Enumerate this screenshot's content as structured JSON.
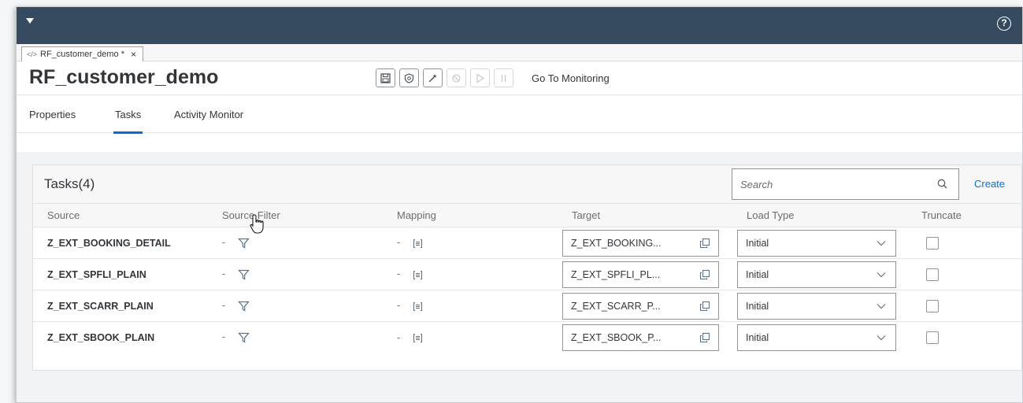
{
  "shell": {
    "help_glyph": "?"
  },
  "doc_tab": {
    "label": "RF_customer_demo *",
    "close": "×"
  },
  "title": "RF_customer_demo",
  "toolbar": {
    "buttons": [
      {
        "name": "save",
        "icon": "save-icon",
        "enabled": true
      },
      {
        "name": "deploy",
        "icon": "shield-icon",
        "enabled": true
      },
      {
        "name": "validate",
        "icon": "magic-wand-icon",
        "enabled": true
      },
      {
        "name": "undeploy",
        "icon": "undeploy-icon",
        "enabled": false
      },
      {
        "name": "run",
        "icon": "play-icon",
        "enabled": false
      },
      {
        "name": "pause",
        "icon": "pause-icon",
        "enabled": false
      }
    ],
    "monitoring_link": "Go To Monitoring"
  },
  "subtabs": [
    {
      "label": "Properties",
      "active": false
    },
    {
      "label": "Tasks",
      "active": true
    },
    {
      "label": "Activity Monitor",
      "active": false
    }
  ],
  "tasks": {
    "title": "Tasks(4)",
    "search_placeholder": "Search",
    "create_label": "Create",
    "columns": [
      "Source",
      "Source Filter",
      "Mapping",
      "Target",
      "Load Type",
      "Truncate"
    ],
    "rows": [
      {
        "source": "Z_EXT_BOOKING_DETAIL",
        "filter_dash": "-",
        "mapping_dash": "-",
        "target": "Z_EXT_BOOKING...",
        "load_type": "Initial",
        "truncate": false
      },
      {
        "source": "Z_EXT_SPFLI_PLAIN",
        "filter_dash": "-",
        "mapping_dash": "-",
        "target": "Z_EXT_SPFLI_PL...",
        "load_type": "Initial",
        "truncate": false
      },
      {
        "source": "Z_EXT_SCARR_PLAIN",
        "filter_dash": "-",
        "mapping_dash": "-",
        "target": "Z_EXT_SCARR_P...",
        "load_type": "Initial",
        "truncate": false
      },
      {
        "source": "Z_EXT_SBOOK_PLAIN",
        "filter_dash": "-",
        "mapping_dash": "-",
        "target": "Z_EXT_SBOOK_P...",
        "load_type": "Initial",
        "truncate": false
      }
    ]
  },
  "colors": {
    "shellbar": "#354a5f",
    "accent": "#0a6ed1",
    "text": "#32363a"
  }
}
